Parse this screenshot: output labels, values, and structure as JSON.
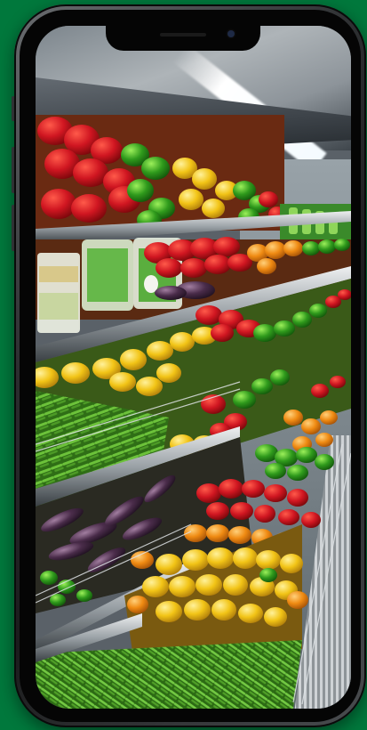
{
  "photo": {
    "subject": "supermarket-produce-aisle",
    "produce": [
      "red-bell-peppers",
      "green-bell-peppers",
      "yellow-bell-peppers",
      "orange-bell-peppers",
      "green-beans",
      "eggplants",
      "tomatoes",
      "limes",
      "packaged-greens"
    ]
  },
  "colors": {
    "background": "#00783c",
    "phone_frame": "#2b2d2f",
    "screen_bezel": "#050505",
    "red_pepper": "#c7121d",
    "green_pepper": "#2f9a1c",
    "yellow_pepper": "#f2c416",
    "orange_pepper": "#ef8a12",
    "green_beans": "#4c9a26",
    "eggplant": "#4a2c4a",
    "shelf": "#9aa1a6"
  },
  "icons": {
    "camera": "front-camera-icon",
    "speaker": "earpiece-speaker-icon"
  }
}
